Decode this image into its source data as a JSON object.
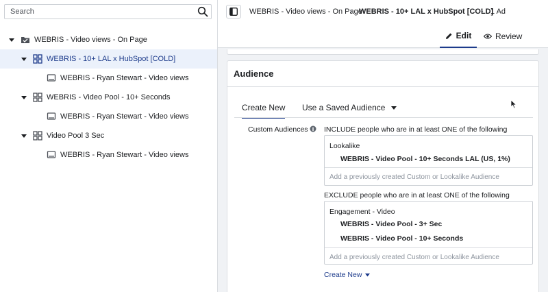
{
  "search": {
    "placeholder": "Search"
  },
  "tree": {
    "campaign": {
      "label": "WEBRIS - Video views - On Page"
    },
    "adsets": [
      {
        "label": "WEBRIS - 10+ LAL x HubSpot [COLD]",
        "ad": "WEBRIS - Ryan Stewart - Video views",
        "selected": true
      },
      {
        "label": "WEBRIS - Video Pool - 10+ Seconds",
        "ad": "WEBRIS - Ryan Stewart - Video views",
        "selected": false
      },
      {
        "label": "Video Pool 3 Sec",
        "ad": "WEBRIS - Ryan Stewart - Video views",
        "selected": false
      }
    ]
  },
  "breadcrumb": {
    "campaign": "WEBRIS - Video views - On Page",
    "adset": "WEBRIS - 10+ LAL x HubSpot [COLD]",
    "ad": "1 Ad"
  },
  "tabs": {
    "edit": "Edit",
    "review": "Review"
  },
  "audience": {
    "title": "Audience",
    "subtabs": {
      "create_new": "Create New",
      "saved": "Use a Saved Audience"
    },
    "custom_label": "Custom Audiences",
    "include": {
      "title": "INCLUDE people who are in at least ONE of the following",
      "group": "Lookalike",
      "items": [
        "WEBRIS - Video Pool - 10+ Seconds LAL (US, 1%)"
      ],
      "placeholder": "Add a previously created Custom or Lookalike Audience"
    },
    "exclude": {
      "title": "EXCLUDE people who are in at least ONE of the following",
      "group": "Engagement - Video",
      "items": [
        "WEBRIS - Video Pool - 3+ Sec",
        "WEBRIS - Video Pool - 10+ Seconds"
      ],
      "placeholder": "Add a previously created Custom or Lookalike Audience"
    },
    "create_new_link": "Create New"
  },
  "colors": {
    "accent": "#1d3b8b",
    "selected_bg": "#ebf1fb"
  }
}
